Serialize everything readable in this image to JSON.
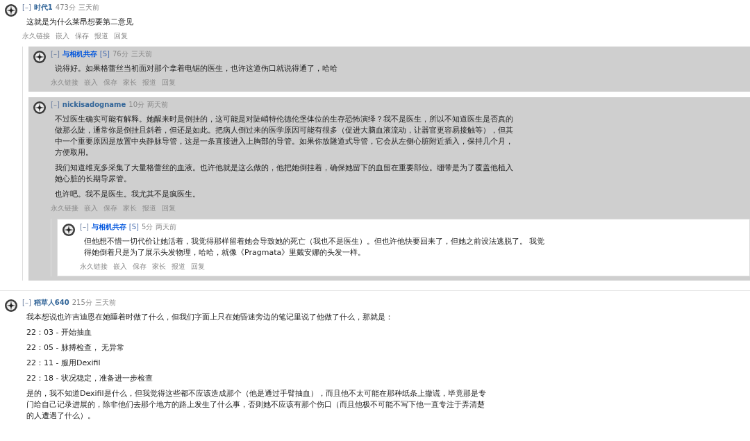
{
  "comments": [
    {
      "toggle": "[–]",
      "user": "时代1",
      "score": "473分",
      "time": "三天前",
      "paragraphs": [
        "这就是为什么莱昂想要第二意见"
      ],
      "actions": [
        "永久链接",
        "嵌入",
        "保存",
        "报道",
        "回复"
      ],
      "children": [
        {
          "toggle": "[–]",
          "user": "与相机共存",
          "tag": "[S]",
          "score": "76分",
          "time": "三天前",
          "paragraphs": [
            "说得好。如果格蕾丝当初面对那个拿着电锯的医生，也许这道伤口就说得通了，哈哈"
          ],
          "actions": [
            "永久链接",
            "嵌入",
            "保存",
            "家长",
            "报道",
            "回复"
          ]
        },
        {
          "toggle": "[–]",
          "user": "nickisadogname",
          "score": "10分",
          "time": "两天前",
          "paragraphs": [
            "不过医生确实可能有解释。她醒来时是倒挂的，这可能是对陡峭特伦德伦堡体位的生存恐怖演绎？我不是医生，所以不知道医生是否真的做那么陡，通常你是倒挂且斜着，但还是如此。把病人倒过来的医学原因可能有很多（促进大脑血液流动，让器官更容易接触等），但其中一个重要原因是放置中央静脉导管，这是一条直接进入上胸部的导管。如果你放隧道式导管，它会从左侧心脏附近插入，保持几个月，方便取用。",
            "我们知道维克多采集了大量格蕾丝的血液。也许他就是这么做的，他把她倒挂着，确保她留下的血留在重要部位。绷带是为了覆盖他植入她心脏的长期导尿管。",
            "也许吧。我不是医生。我尤其不是疯医生。"
          ],
          "actions": [
            "永久链接",
            "嵌入",
            "保存",
            "家长",
            "报道",
            "回复"
          ],
          "children": [
            {
              "toggle": "[–]",
              "user": "与相机共存",
              "tag": "[S]",
              "score": "5分",
              "time": "两天前",
              "paragraphs": [
                "但他想不惜一切代价让她活着，我觉得那样留着她会导致她的死亡（我也不是医生）。但也许他快要回来了，但她之前设法逃脱了。 我觉得她倒着只是为了展示头发物理，哈哈，就像《Pragmata》里戴安娜的头发一样。"
              ],
              "actions": [
                "永久链接",
                "嵌入",
                "保存",
                "家长",
                "报道",
                "回复"
              ]
            }
          ]
        }
      ]
    },
    {
      "toggle": "[–]",
      "user": "稻草人640",
      "score": "215分",
      "time": "三天前",
      "paragraphs": [
        "我本想说也许吉迪恩在她睡着时做了什么，但我们字面上只在她昏迷旁边的笔记里说了他做了什么，那就是：",
        "22：03 - 开始抽血",
        "22：05 - 脉搏检查， 无异常",
        "22：11 - 服用Dexifil",
        "22：18 - 状况稳定，准备进一步检查",
        "是的，我不知道Dexifil是什么，但我觉得这些都不应该造成那个（他是通过手臂抽血），而且他不太可能在那种纸条上撒谎，毕竟那是专门给自己记录进展的，除非他们去那个地方的路上发生了什么事，否则她不应该有那个伤口（而且他极不可能不写下他一直专注于弄清楚的人遭遇了什么）。"
      ]
    }
  ]
}
